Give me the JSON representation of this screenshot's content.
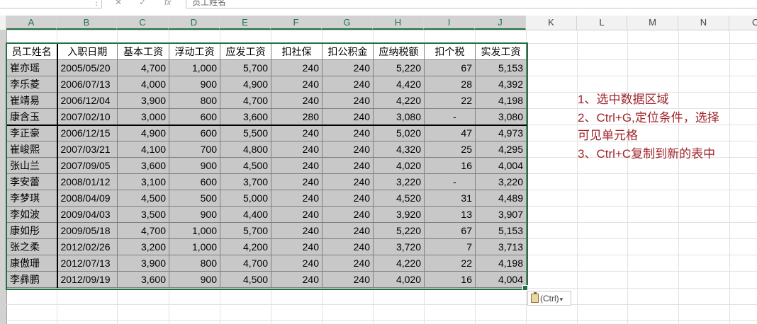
{
  "formula_bar": {
    "name_box": "",
    "formula": "员工姓名"
  },
  "columns": [
    "A",
    "B",
    "C",
    "D",
    "E",
    "F",
    "G",
    "H",
    "I",
    "J",
    "K",
    "L",
    "M",
    "N",
    "O"
  ],
  "table": {
    "headers": [
      "员工姓名",
      "入职日期",
      "基本工资",
      "浮动工资",
      "应发工资",
      "扣社保",
      "扣公积金",
      "应纳税额",
      "扣个税",
      "实发工资"
    ],
    "rows": [
      [
        "崔亦瑶",
        "2005/05/20",
        "4,700",
        "1,000",
        "5,700",
        "240",
        "240",
        "5,220",
        "67",
        "5,153"
      ],
      [
        "李乐菱",
        "2006/07/13",
        "4,000",
        "900",
        "4,900",
        "240",
        "240",
        "4,420",
        "28",
        "4,392"
      ],
      [
        "崔靖易",
        "2006/12/04",
        "3,900",
        "800",
        "4,700",
        "240",
        "240",
        "4,220",
        "22",
        "4,198"
      ],
      [
        "康含玉",
        "2007/02/10",
        "3,000",
        "600",
        "3,600",
        "280",
        "240",
        "3,080",
        "-",
        "3,080"
      ],
      [
        "李正豪",
        "2006/12/15",
        "4,900",
        "600",
        "5,500",
        "240",
        "240",
        "5,020",
        "47",
        "4,973"
      ],
      [
        "崔峻熙",
        "2007/03/21",
        "4,100",
        "700",
        "4,800",
        "240",
        "240",
        "4,320",
        "25",
        "4,295"
      ],
      [
        "张山兰",
        "2007/09/05",
        "3,600",
        "900",
        "4,500",
        "240",
        "240",
        "4,020",
        "16",
        "4,004"
      ],
      [
        "李安蕾",
        "2008/01/12",
        "3,100",
        "600",
        "3,700",
        "240",
        "240",
        "3,220",
        "-",
        "3,220"
      ],
      [
        "李梦琪",
        "2008/04/09",
        "4,500",
        "500",
        "5,000",
        "240",
        "240",
        "4,520",
        "31",
        "4,489"
      ],
      [
        "李如波",
        "2009/04/03",
        "3,500",
        "900",
        "4,400",
        "240",
        "240",
        "3,920",
        "13",
        "3,907"
      ],
      [
        "康如彤",
        "2009/05/18",
        "4,700",
        "1,000",
        "5,700",
        "240",
        "240",
        "5,220",
        "67",
        "5,153"
      ],
      [
        "张之柔",
        "2012/02/26",
        "3,200",
        "1,000",
        "4,200",
        "240",
        "240",
        "3,720",
        "7",
        "3,713"
      ],
      [
        "康傲珊",
        "2012/07/13",
        "3,900",
        "800",
        "4,700",
        "240",
        "240",
        "4,220",
        "22",
        "4,198"
      ],
      [
        "李彝鹏",
        "2012/09/19",
        "3,600",
        "900",
        "4,500",
        "240",
        "240",
        "4,020",
        "16",
        "4,004"
      ]
    ]
  },
  "notes": [
    "1、选中数据区域",
    "2、Ctrl+G,定位条件，选择",
    "可见单元格",
    "3、Ctrl+C复制到新的表中"
  ],
  "paste_options": {
    "label": "(Ctrl)",
    "arrow": "▾"
  },
  "colors": {
    "selection": "#217346",
    "note_text": "#a1252b",
    "selected_fill": "#c8c8c8"
  }
}
